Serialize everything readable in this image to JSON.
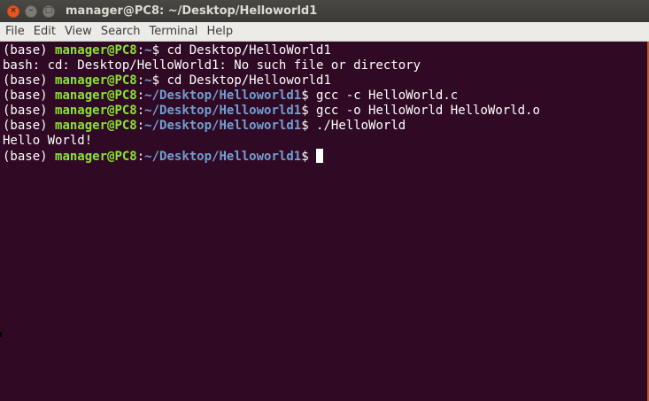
{
  "window": {
    "title": "manager@PC8: ~/Desktop/Helloworld1",
    "close_glyph": "×",
    "minimize_glyph": "–",
    "maximize_glyph": "□"
  },
  "menu": [
    "File",
    "Edit",
    "View",
    "Search",
    "Terminal",
    "Help"
  ],
  "terminal": {
    "lines": [
      {
        "env": "(base) ",
        "user": "manager@PC8",
        "sep": ":",
        "path": "~",
        "prompt": "$ ",
        "cmd": "cd Desktop/HelloWorld1"
      },
      {
        "text": "bash: cd: Desktop/HelloWorld1: No such file or directory"
      },
      {
        "env": "(base) ",
        "user": "manager@PC8",
        "sep": ":",
        "path": "~",
        "prompt": "$ ",
        "cmd": "cd Desktop/Helloworld1"
      },
      {
        "env": "(base) ",
        "user": "manager@PC8",
        "sep": ":",
        "path": "~/Desktop/Helloworld1",
        "prompt": "$ ",
        "cmd": "gcc -c HelloWorld.c"
      },
      {
        "env": "(base) ",
        "user": "manager@PC8",
        "sep": ":",
        "path": "~/Desktop/Helloworld1",
        "prompt": "$ ",
        "cmd": "gcc -o HelloWorld HelloWorld.o"
      },
      {
        "env": "(base) ",
        "user": "manager@PC8",
        "sep": ":",
        "path": "~/Desktop/Helloworld1",
        "prompt": "$ ",
        "cmd": "./HelloWorld"
      },
      {
        "text": "Hello World!"
      },
      {
        "env": "(base) ",
        "user": "manager@PC8",
        "sep": ":",
        "path": "~/Desktop/Helloworld1",
        "prompt": "$ ",
        "cmd": ""
      }
    ]
  },
  "colors": {
    "background": "#300a24",
    "user": "#8ae234",
    "path": "#729fcf",
    "text": "#ffffff",
    "close_button": "#e95420"
  }
}
